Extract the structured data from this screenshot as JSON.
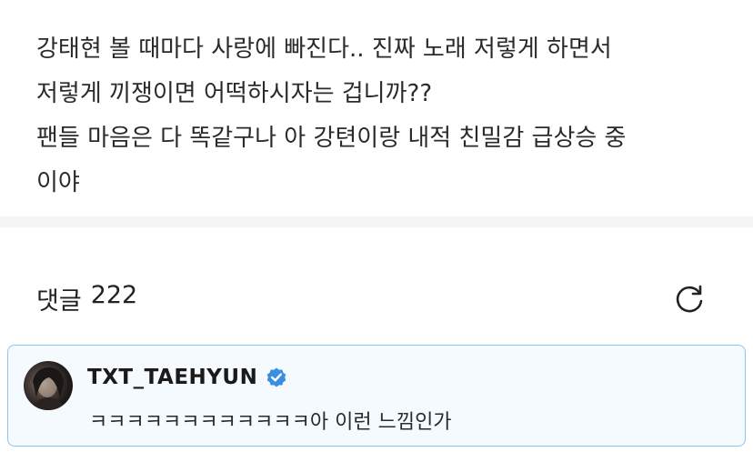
{
  "post": {
    "lines": [
      "강태현 볼 때마다 사랑에 빠진다.. 진짜 노래 저렇게 하면서",
      "저렇게 끼쟁이면 어떡하시자는 겁니까??",
      "팬들 마음은 다 똑같구나 아 강텬이랑 내적 친밀감 급상승 중",
      "이야"
    ]
  },
  "comments": {
    "label": "댓글",
    "count": "222",
    "refresh_icon": "refresh-icon",
    "items": [
      {
        "author": "TXT_TAEHYUN",
        "verified_icon": "verified-badge-icon",
        "text": "ㅋㅋㅋㅋㅋㅋㅋㅋㅋㅋㅋㅋ아 이런 느낌인가"
      }
    ]
  },
  "colors": {
    "verified": "#3b8fe0",
    "card_border": "#8ec5ee",
    "card_bg": "#f4fafe",
    "divider": "#f5f5f7"
  }
}
